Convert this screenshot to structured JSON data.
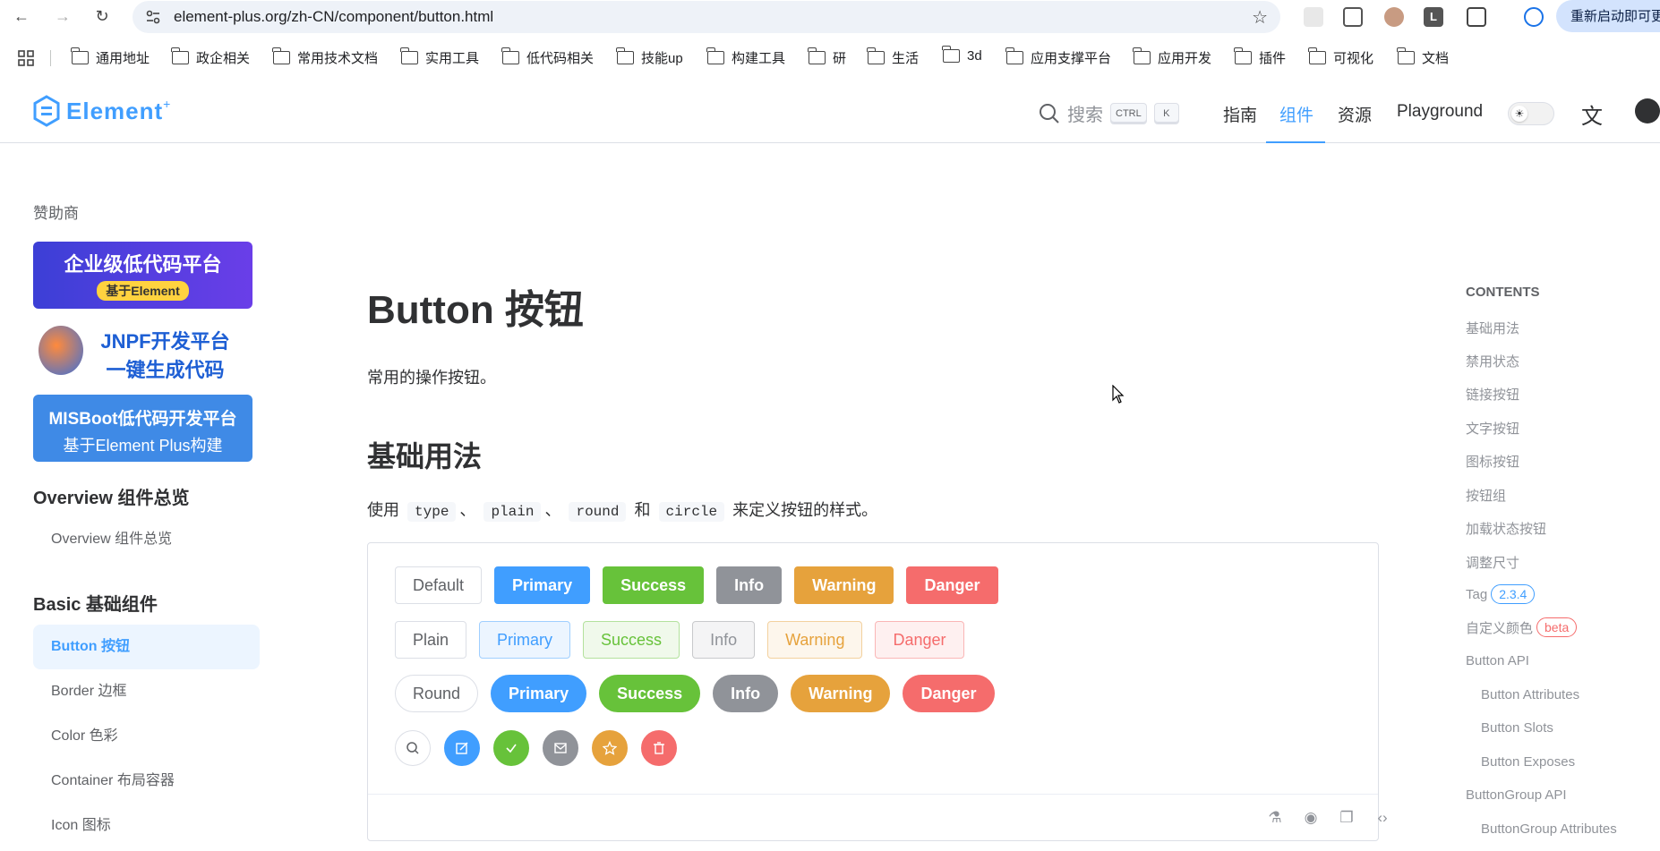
{
  "browser": {
    "url": "element-plus.org/zh-CN/component/button.html",
    "restart_label": "重新启动即可更",
    "bookmarks": [
      "通用地址",
      "政企相关",
      "常用技术文档",
      "实用工具",
      "低代码相关",
      "技能up",
      "构建工具",
      "研",
      "生活",
      "3d",
      "应用支撑平台",
      "应用开发",
      "插件",
      "可视化",
      "文档"
    ]
  },
  "header": {
    "logo_text": "Element",
    "logo_sup": "+",
    "search_label": "搜索",
    "kbd_ctrl": "CTRL",
    "kbd_k": "K",
    "nav": [
      "指南",
      "组件",
      "资源",
      "Playground"
    ],
    "active_nav": "组件"
  },
  "sidebar": {
    "sponsor_title": "赞助商",
    "sponsor1_title": "企业级低代码平台",
    "sponsor1_badge": "基于Element",
    "sponsor2_title": "JNPF开发平台",
    "sponsor2_sub": "一键生成代码",
    "sponsor3_title": "MISBoot低代码开发平台",
    "sponsor3_sub": "基于Element Plus构建",
    "group_overview": "Overview 组件总览",
    "item_overview": "Overview 组件总览",
    "group_basic": "Basic 基础组件",
    "items": [
      "Button 按钮",
      "Border 边框",
      "Color 色彩",
      "Container 布局容器",
      "Icon 图标"
    ]
  },
  "main": {
    "title": "Button 按钮",
    "desc": "常用的操作按钮。",
    "section_title": "基础用法",
    "section_desc_prefix": "使用",
    "code_type": "type",
    "sep1": "、",
    "code_plain": "plain",
    "sep2": "、",
    "code_round": "round",
    "and": "和",
    "code_circle": "circle",
    "section_desc_suffix": "来定义按钮的样式。",
    "row1": [
      "Default",
      "Primary",
      "Success",
      "Info",
      "Warning",
      "Danger"
    ],
    "row2": [
      "Plain",
      "Primary",
      "Success",
      "Info",
      "Warning",
      "Danger"
    ],
    "row3": [
      "Round",
      "Primary",
      "Success",
      "Info",
      "Warning",
      "Danger"
    ]
  },
  "colors": {
    "primary": "#409eff",
    "success": "#67c23a",
    "info": "#909399",
    "warning": "#e6a23c",
    "danger": "#f56c6c"
  },
  "toc": {
    "title": "CONTENTS",
    "items": [
      "基础用法",
      "禁用状态",
      "链接按钮",
      "文字按钮",
      "图标按钮",
      "按钮组",
      "加载状态按钮",
      "调整尺寸",
      "Tag",
      "自定义颜色",
      "Button API",
      "Button Attributes",
      "Button Slots",
      "Button Exposes",
      "ButtonGroup API",
      "ButtonGroup Attributes"
    ],
    "tag_version": "2.3.4",
    "tag_beta": "beta"
  }
}
